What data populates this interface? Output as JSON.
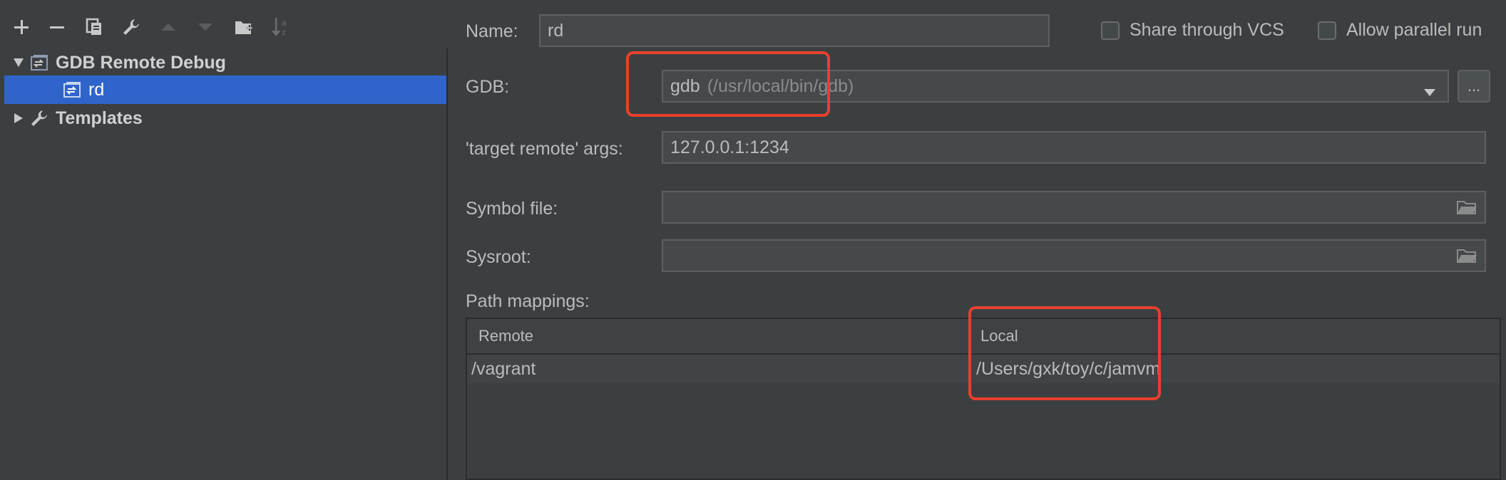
{
  "toolbar": {
    "icons": [
      "add-icon",
      "remove-icon",
      "copy-icon",
      "wrench-icon",
      "move-up-icon",
      "move-down-icon",
      "new-folder-icon",
      "sort-alpha-icon"
    ]
  },
  "tree": {
    "group_label": "GDB Remote Debug",
    "child_label": "rd",
    "templates_label": "Templates"
  },
  "form": {
    "name_label": "Name:",
    "name_value": "rd",
    "share_vcs_label": "Share through VCS",
    "parallel_run_label": "Allow parallel run",
    "gdb_label": "GDB:",
    "gdb_value": "gdb",
    "gdb_path": "(/usr/local/bin/gdb)",
    "ellipsis_label": "...",
    "target_args_label": "'target remote' args:",
    "target_args_value": "127.0.0.1:1234",
    "symbol_file_label": "Symbol file:",
    "symbol_file_value": "",
    "sysroot_label": "Sysroot:",
    "sysroot_value": "",
    "path_mappings_label": "Path mappings:"
  },
  "path_mappings": {
    "columns": [
      "Remote",
      "Local"
    ],
    "rows": [
      {
        "remote": "/vagrant",
        "local": "/Users/gxk/toy/c/jamvm"
      }
    ]
  },
  "colors": {
    "selection": "#2f65ca",
    "highlight": "#e8402c",
    "background": "#3c3f41"
  }
}
